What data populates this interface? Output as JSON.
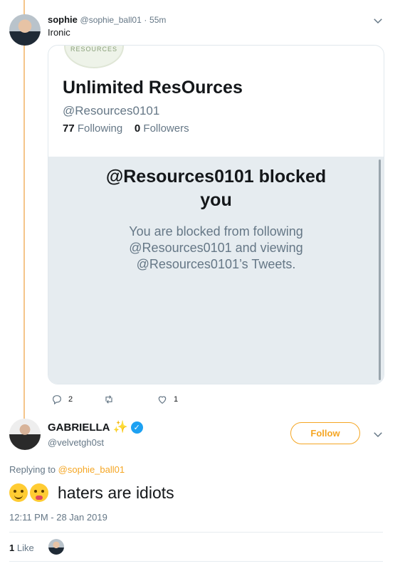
{
  "quoted_tweet": {
    "author_name": "sophie",
    "author_handle": "@sophie_ball01",
    "time_sep": "·",
    "time": "55m",
    "text": "Ironic",
    "icon": "chevron-down-icon"
  },
  "embedded_card": {
    "logo_text": "RESOURCES",
    "title": "Unlimited ResOurces",
    "handle": "@Resources0101",
    "following_count": "77",
    "following_label": "Following",
    "followers_count": "0",
    "followers_label": "Followers",
    "blocked_title_line1": "@Resources0101 blocked",
    "blocked_title_line2": "you",
    "blocked_body_line1": "You are blocked from following",
    "blocked_body_line2": "@Resources0101 and viewing",
    "blocked_body_line3": "@Resources0101’s Tweets."
  },
  "actions": {
    "reply_count": "2",
    "retweet_count": "",
    "like_count": "1"
  },
  "reply": {
    "author_name": "GABRIELLA",
    "author_handle": "@velvetgh0st",
    "follow_label": "Follow",
    "replying_prefix": "Replying to",
    "replying_to": "@sophie_ball01",
    "text": "haters are idiots",
    "timestamp": "12:11 PM - 28 Jan 2019",
    "like_count": "1",
    "like_label": "Like"
  },
  "colors": {
    "accent": "#f5a623",
    "verified": "#1da1f2",
    "thread_line": "#f5c58a",
    "muted": "#657786"
  }
}
